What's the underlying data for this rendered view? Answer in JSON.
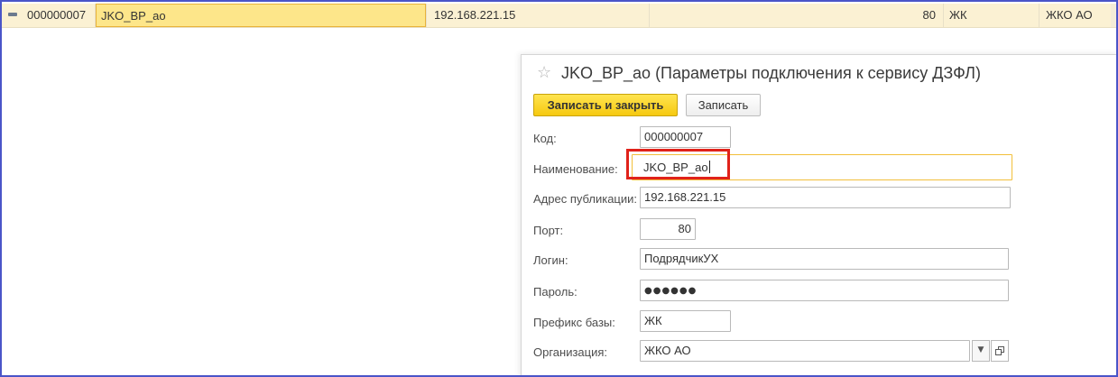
{
  "list_row": {
    "code": "000000007",
    "name": "JKO_BP_ao",
    "address": "192.168.221.15",
    "port": "80",
    "prefix": "ЖК",
    "organization": "ЖКО АО"
  },
  "dialog": {
    "title": "JKO_BP_ao (Параметры подключения к сервису ДЗФЛ)",
    "buttons": {
      "save_close": "Записать и закрыть",
      "save": "Записать"
    },
    "fields": {
      "code": {
        "label": "Код:",
        "value": "000000007"
      },
      "name": {
        "label": "Наименование:",
        "value": "JKO_BP_ao"
      },
      "address": {
        "label": "Адрес публикации:",
        "value": "192.168.221.15"
      },
      "port": {
        "label": "Порт:",
        "value": "80"
      },
      "login": {
        "label": "Логин:",
        "value": "ПодрядчикУХ"
      },
      "password": {
        "label": "Пароль:",
        "value": "●●●●●●"
      },
      "prefix": {
        "label": "Префикс базы:",
        "value": "ЖК"
      },
      "organization": {
        "label": "Организация:",
        "value": "ЖКО АО"
      }
    }
  },
  "icons": {
    "row_icon": "row-state-icon",
    "favorite": "star-icon",
    "dropdown": "chevron-down-icon",
    "open": "open-form-icon"
  },
  "colors": {
    "frame": "#4a55c8",
    "row_bg": "#fbf1d3",
    "selected_cell": "#fde68a",
    "primary_button": "#f6c910",
    "highlight": "#e0221a",
    "focus_border": "#f2bf3a"
  }
}
